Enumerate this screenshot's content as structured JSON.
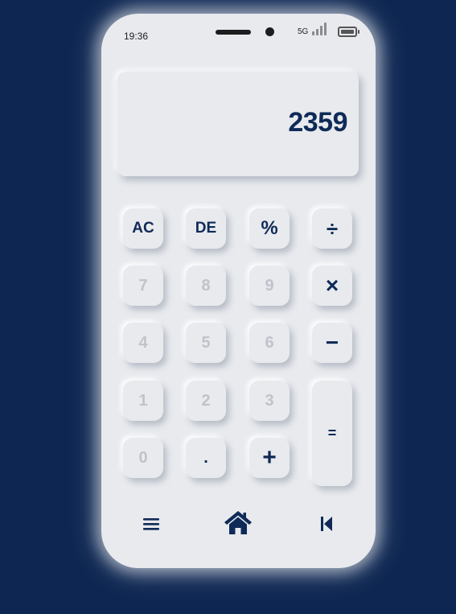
{
  "status_bar": {
    "time": "19:36",
    "network": "5G"
  },
  "display": {
    "value": "2359"
  },
  "keys": {
    "ac": "AC",
    "de": "DE",
    "percent": "%",
    "divide": "÷",
    "seven": "7",
    "eight": "8",
    "nine": "9",
    "multiply": "×",
    "four": "4",
    "five": "5",
    "six": "6",
    "minus": "−",
    "one": "1",
    "two": "2",
    "three": "3",
    "zero": "0",
    "dot": ".",
    "plus": "+",
    "equals": "="
  },
  "bottom_nav": {
    "icons": [
      "menu-icon",
      "home-icon",
      "skip-back-icon"
    ]
  },
  "colors": {
    "background": "#0e2752",
    "surface": "#e8eaee",
    "accent": "#0f2a57",
    "muted_digit": "#c0c3c9"
  }
}
